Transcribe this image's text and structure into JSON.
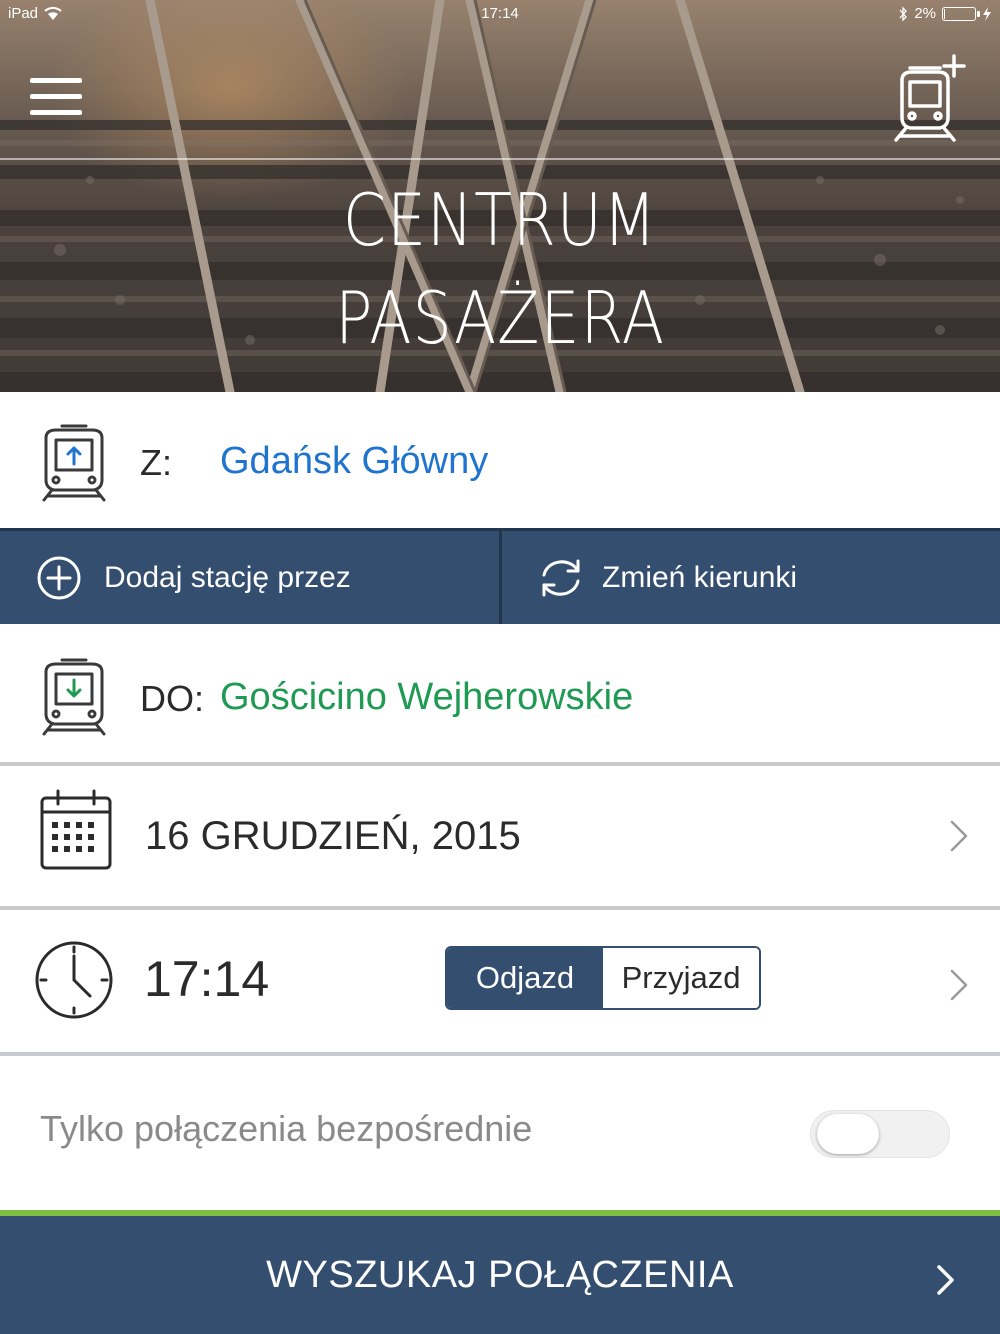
{
  "status_bar": {
    "device": "iPad",
    "time": "17:14",
    "battery": "2%",
    "battery_level": 0.02
  },
  "header": {
    "title_line1": "CENTRUM",
    "title_line2": "PASAŻERA",
    "menu_icon": "hamburger-menu-icon",
    "add_train_icon": "train-add-icon"
  },
  "from": {
    "label": "Z:",
    "station": "Gdańsk Główny",
    "color": "#1f74d0",
    "icon": "train-departure-icon"
  },
  "actions": {
    "add_via": "Dodaj stację przez",
    "swap": "Zmień kierunki",
    "add_icon": "plus-circle-icon",
    "swap_icon": "swap-arrows-icon"
  },
  "to": {
    "label": "DO:",
    "station": "Gościcino Wejherowskie",
    "color": "#1f9a52",
    "icon": "train-arrival-icon"
  },
  "date": {
    "value": "16 GRUDZIEŃ, 2015",
    "icon": "calendar-icon"
  },
  "time": {
    "value": "17:14",
    "icon": "clock-icon",
    "mode_options": [
      "Odjazd",
      "Przyjazd"
    ],
    "selected_mode": "Odjazd"
  },
  "direct_only": {
    "label": "Tylko połączenia bezpośrednie",
    "enabled": false
  },
  "search": {
    "label": "WYSZUKAJ POŁĄCZENIA",
    "icon": "chevron-right-icon"
  },
  "colors": {
    "navy": "#344e6f",
    "accent_green": "#7cbf44"
  }
}
